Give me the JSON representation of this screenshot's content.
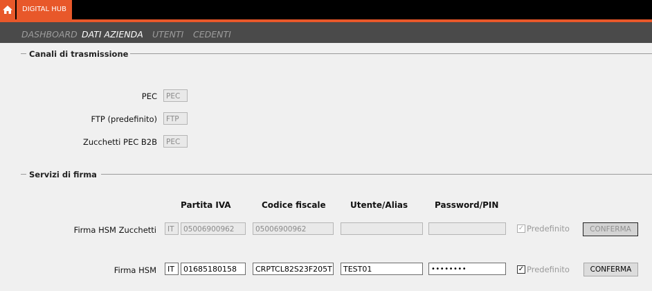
{
  "header": {
    "brand": "DIGITAL HUB",
    "home_icon": "home-icon",
    "accent_color": "#e8582a"
  },
  "nav": {
    "items": [
      {
        "label": "DASHBOARD"
      },
      {
        "label": "DATI AZIENDA"
      },
      {
        "label": "UTENTI"
      },
      {
        "label": "CEDENTI"
      }
    ]
  },
  "canali": {
    "title": "Canali di trasmissione",
    "rows": [
      {
        "label": "PEC",
        "value": "PEC"
      },
      {
        "label": "FTP (predefinito)",
        "value": "FTP"
      },
      {
        "label": "Zucchetti PEC B2B",
        "value": "PEC"
      }
    ]
  },
  "firma": {
    "title": "Servizi di firma",
    "columns": {
      "partita_iva": "Partita IVA",
      "codice_fiscale": "Codice fiscale",
      "utente": "Utente/Alias",
      "password": "Password/PIN"
    },
    "rows": [
      {
        "label": "Firma HSM Zucchetti",
        "country": "IT",
        "partita_iva": "05006900962",
        "codice_fiscale": "05006900962",
        "utente": "",
        "password": "",
        "predefinito_label": "Predefinito",
        "predefinito_checked": true,
        "button": "CONFERMA"
      },
      {
        "label": "Firma HSM",
        "country": "IT",
        "partita_iva": "01685180158",
        "codice_fiscale": "CRPTCL82S23F205T",
        "utente": "TEST01",
        "password": "••••••••",
        "predefinito_label": "Predefinito",
        "predefinito_checked": true,
        "button": "CONFERMA"
      }
    ]
  }
}
